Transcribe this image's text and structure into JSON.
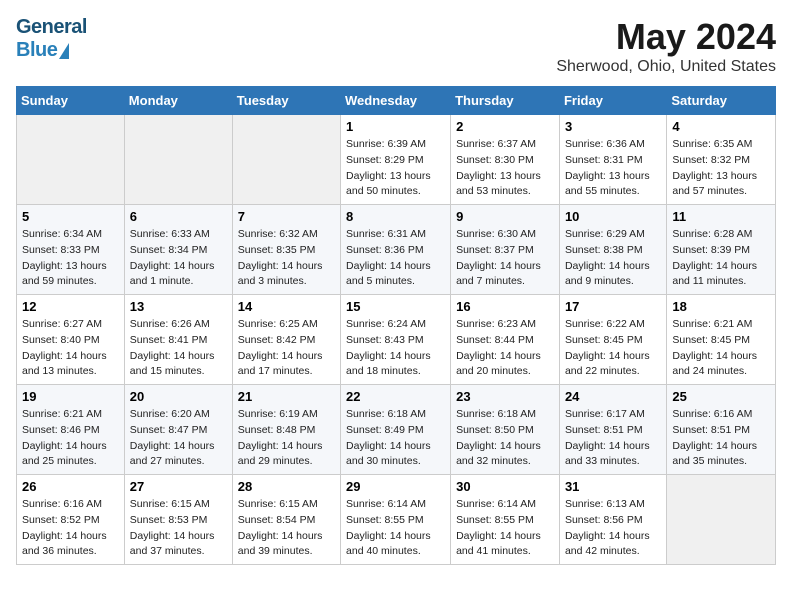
{
  "header": {
    "logo_general": "General",
    "logo_blue": "Blue",
    "title": "May 2024",
    "subtitle": "Sherwood, Ohio, United States"
  },
  "weekdays": [
    "Sunday",
    "Monday",
    "Tuesday",
    "Wednesday",
    "Thursday",
    "Friday",
    "Saturday"
  ],
  "weeks": [
    [
      {
        "day": "",
        "empty": true
      },
      {
        "day": "",
        "empty": true
      },
      {
        "day": "",
        "empty": true
      },
      {
        "day": "1",
        "sunrise": "6:39 AM",
        "sunset": "8:29 PM",
        "daylight": "13 hours and 50 minutes."
      },
      {
        "day": "2",
        "sunrise": "6:37 AM",
        "sunset": "8:30 PM",
        "daylight": "13 hours and 53 minutes."
      },
      {
        "day": "3",
        "sunrise": "6:36 AM",
        "sunset": "8:31 PM",
        "daylight": "13 hours and 55 minutes."
      },
      {
        "day": "4",
        "sunrise": "6:35 AM",
        "sunset": "8:32 PM",
        "daylight": "13 hours and 57 minutes."
      }
    ],
    [
      {
        "day": "5",
        "sunrise": "6:34 AM",
        "sunset": "8:33 PM",
        "daylight": "13 hours and 59 minutes."
      },
      {
        "day": "6",
        "sunrise": "6:33 AM",
        "sunset": "8:34 PM",
        "daylight": "14 hours and 1 minute."
      },
      {
        "day": "7",
        "sunrise": "6:32 AM",
        "sunset": "8:35 PM",
        "daylight": "14 hours and 3 minutes."
      },
      {
        "day": "8",
        "sunrise": "6:31 AM",
        "sunset": "8:36 PM",
        "daylight": "14 hours and 5 minutes."
      },
      {
        "day": "9",
        "sunrise": "6:30 AM",
        "sunset": "8:37 PM",
        "daylight": "14 hours and 7 minutes."
      },
      {
        "day": "10",
        "sunrise": "6:29 AM",
        "sunset": "8:38 PM",
        "daylight": "14 hours and 9 minutes."
      },
      {
        "day": "11",
        "sunrise": "6:28 AM",
        "sunset": "8:39 PM",
        "daylight": "14 hours and 11 minutes."
      }
    ],
    [
      {
        "day": "12",
        "sunrise": "6:27 AM",
        "sunset": "8:40 PM",
        "daylight": "14 hours and 13 minutes."
      },
      {
        "day": "13",
        "sunrise": "6:26 AM",
        "sunset": "8:41 PM",
        "daylight": "14 hours and 15 minutes."
      },
      {
        "day": "14",
        "sunrise": "6:25 AM",
        "sunset": "8:42 PM",
        "daylight": "14 hours and 17 minutes."
      },
      {
        "day": "15",
        "sunrise": "6:24 AM",
        "sunset": "8:43 PM",
        "daylight": "14 hours and 18 minutes."
      },
      {
        "day": "16",
        "sunrise": "6:23 AM",
        "sunset": "8:44 PM",
        "daylight": "14 hours and 20 minutes."
      },
      {
        "day": "17",
        "sunrise": "6:22 AM",
        "sunset": "8:45 PM",
        "daylight": "14 hours and 22 minutes."
      },
      {
        "day": "18",
        "sunrise": "6:21 AM",
        "sunset": "8:45 PM",
        "daylight": "14 hours and 24 minutes."
      }
    ],
    [
      {
        "day": "19",
        "sunrise": "6:21 AM",
        "sunset": "8:46 PM",
        "daylight": "14 hours and 25 minutes."
      },
      {
        "day": "20",
        "sunrise": "6:20 AM",
        "sunset": "8:47 PM",
        "daylight": "14 hours and 27 minutes."
      },
      {
        "day": "21",
        "sunrise": "6:19 AM",
        "sunset": "8:48 PM",
        "daylight": "14 hours and 29 minutes."
      },
      {
        "day": "22",
        "sunrise": "6:18 AM",
        "sunset": "8:49 PM",
        "daylight": "14 hours and 30 minutes."
      },
      {
        "day": "23",
        "sunrise": "6:18 AM",
        "sunset": "8:50 PM",
        "daylight": "14 hours and 32 minutes."
      },
      {
        "day": "24",
        "sunrise": "6:17 AM",
        "sunset": "8:51 PM",
        "daylight": "14 hours and 33 minutes."
      },
      {
        "day": "25",
        "sunrise": "6:16 AM",
        "sunset": "8:51 PM",
        "daylight": "14 hours and 35 minutes."
      }
    ],
    [
      {
        "day": "26",
        "sunrise": "6:16 AM",
        "sunset": "8:52 PM",
        "daylight": "14 hours and 36 minutes."
      },
      {
        "day": "27",
        "sunrise": "6:15 AM",
        "sunset": "8:53 PM",
        "daylight": "14 hours and 37 minutes."
      },
      {
        "day": "28",
        "sunrise": "6:15 AM",
        "sunset": "8:54 PM",
        "daylight": "14 hours and 39 minutes."
      },
      {
        "day": "29",
        "sunrise": "6:14 AM",
        "sunset": "8:55 PM",
        "daylight": "14 hours and 40 minutes."
      },
      {
        "day": "30",
        "sunrise": "6:14 AM",
        "sunset": "8:55 PM",
        "daylight": "14 hours and 41 minutes."
      },
      {
        "day": "31",
        "sunrise": "6:13 AM",
        "sunset": "8:56 PM",
        "daylight": "14 hours and 42 minutes."
      },
      {
        "day": "",
        "empty": true
      }
    ]
  ],
  "labels": {
    "sunrise": "Sunrise:",
    "sunset": "Sunset:",
    "daylight": "Daylight:"
  }
}
